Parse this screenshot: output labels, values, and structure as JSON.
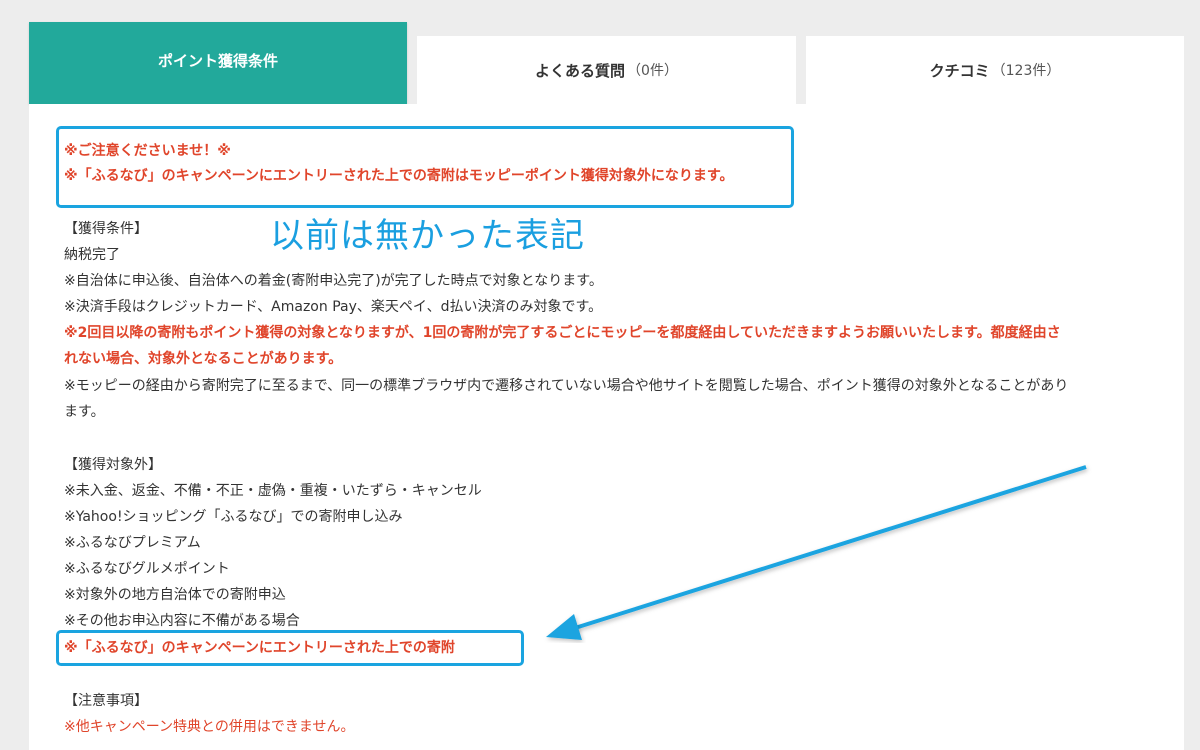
{
  "tabs": [
    {
      "label": "ポイント獲得条件",
      "count": ""
    },
    {
      "label": "よくある質問",
      "count": "（0件）"
    },
    {
      "label": "クチコミ",
      "count": "（123件）"
    }
  ],
  "notice": {
    "line1": "※ご注意くださいませ！※",
    "line2": "※「ふるなび」のキャンペーンにエントリーされた上での寄附はモッピーポイント獲得対象外になります。"
  },
  "annotation": "以前は無かった表記",
  "conditions": {
    "heading": "【獲得条件】",
    "items": [
      "納税完了",
      "※自治体に申込後、自治体への着金(寄附申込完了)が完了した時点で対象となります。",
      "※決済手段はクレジットカード、Amazon Pay、楽天ペイ、d払い決済のみ対象です。",
      "※2回目以降の寄附もポイント獲得の対象となりますが、1回の寄附が完了するごとにモッピーを都度経由していただきますようお願いいたします。都度経由さ",
      "れない場合、対象外となることがあります。",
      "※モッピーの経由から寄附完了に至るまで、同一の標準ブラウザ内で遷移されていない場合や他サイトを閲覧した場合、ポイント獲得の対象外となることがあり",
      "ます。"
    ]
  },
  "excluded": {
    "heading": "【獲得対象外】",
    "items": [
      "※未入金、返金、不備・不正・虚偽・重複・いたずら・キャンセル",
      "※Yahoo!ショッピング「ふるなび」での寄附申し込み",
      "※ふるなびプレミアム",
      "※ふるなびグルメポイント",
      "※対象外の地方自治体での寄附申込",
      "※その他お申込内容に不備がある場合",
      "※「ふるなび」のキャンペーンにエントリーされた上での寄附"
    ]
  },
  "notes": {
    "heading": "【注意事項】",
    "items": [
      "※他キャンペーン特典との併用はできません。"
    ]
  },
  "colors": {
    "accent": "#22a99b",
    "warning": "#e0452b",
    "annotation": "#1aa4e0"
  }
}
